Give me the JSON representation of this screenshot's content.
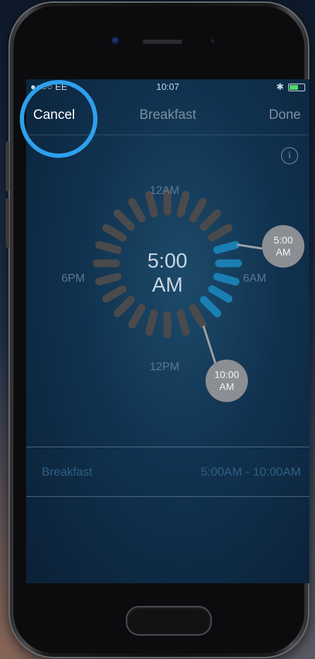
{
  "status_bar": {
    "carrier": "●●○○ EE",
    "time": "10:07",
    "icons": [
      "wifi-icon",
      "bluetooth-icon",
      "battery-icon"
    ]
  },
  "nav": {
    "cancel_label": "Cancel",
    "title": "Breakfast",
    "done_label": "Done"
  },
  "info_glyph": "i",
  "dial": {
    "label_top": "12AM",
    "label_left": "6PM",
    "label_right": "6AM",
    "label_bottom": "12PM",
    "center_time_line1": "5:00",
    "center_time_line2": "AM",
    "start_handle": {
      "line1": "5:00",
      "line2": "AM"
    },
    "end_handle": {
      "line1": "10:00",
      "line2": "AM"
    }
  },
  "row": {
    "name": "Breakfast",
    "range": "5:00AM  -  10:00AM"
  },
  "colors": {
    "accent_ring": "#2ea0ec",
    "active_segment": "#1a7fb3",
    "inactive_segment": "#4a4a4c"
  }
}
